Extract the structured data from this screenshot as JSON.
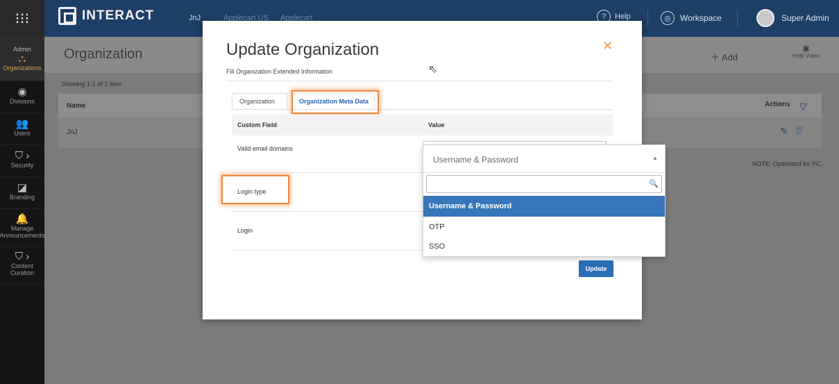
{
  "topbar": {
    "logo_text": "INTERACT",
    "breadcrumb": [
      "JnJ",
      "Applecart US",
      "Applecart"
    ],
    "help_label": "Help",
    "workspace_label": "Workspace",
    "user_name": "Super Admin"
  },
  "sidebar": {
    "admin_label": "Admin",
    "items": [
      {
        "label": "Organizations",
        "icon": "org-chart-icon"
      },
      {
        "label": "Divisions",
        "icon": "target-icon"
      },
      {
        "label": "Users",
        "icon": "users-icon"
      },
      {
        "label": "Security",
        "icon": "shield-icon"
      },
      {
        "label": "Branding",
        "icon": "edit-square-icon"
      },
      {
        "label": "Manage Announcements",
        "icon": "bell-icon"
      },
      {
        "label": "Content Curation",
        "icon": "shield-icon"
      }
    ]
  },
  "main": {
    "page_title": "Organization",
    "add_label": "Add",
    "help_video_label": "Help Video",
    "showing_text": "Showing 1-1 of 1 item.",
    "table": {
      "col_name": "Name",
      "col_actions": "Actions",
      "rows": [
        {
          "name": "JnJ"
        }
      ]
    },
    "note": "NOTE: Optimized for PC."
  },
  "modal": {
    "title": "Update Organization",
    "subtitle": "Fill Organization Extended Information",
    "tabs": [
      {
        "label": "Organization",
        "active": false
      },
      {
        "label": "Organization Meta Data",
        "active": true
      }
    ],
    "table": {
      "col_field": "Custom Field",
      "col_value": "Value",
      "rows": [
        {
          "field": "Valid email domains"
        },
        {
          "field": "Login type"
        },
        {
          "field": "Login"
        }
      ]
    },
    "update_label": "Update"
  },
  "dropdown": {
    "selected": "Username & Password",
    "search_value": "",
    "options": [
      "Username & Password",
      "OTP",
      "SSO"
    ],
    "highlighted_index": 0
  },
  "colors": {
    "topbar": "#1e3f66",
    "accent": "#2a6fb5",
    "highlight": "#f0883e",
    "active_sidebar": "#d9a34b"
  }
}
